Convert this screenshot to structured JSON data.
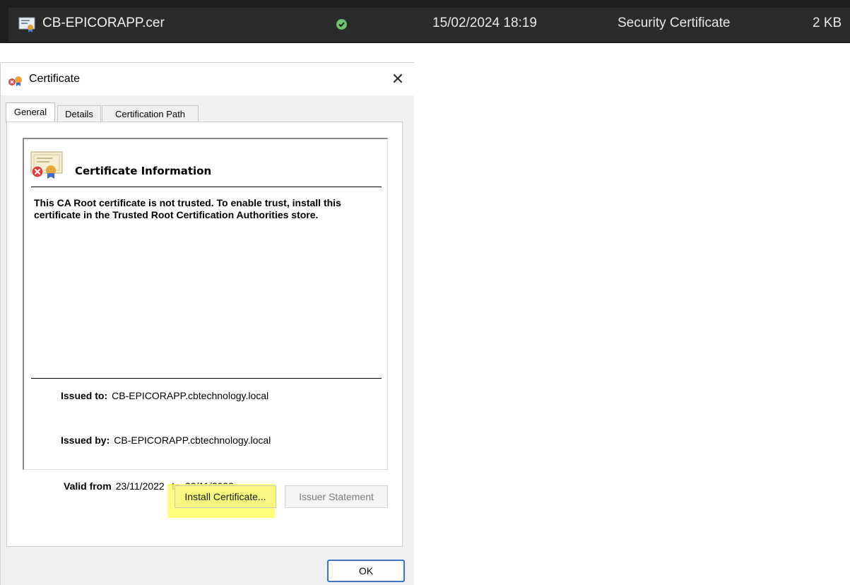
{
  "file_row": {
    "name": "CB-EPICORAPP.cer",
    "date": "15/02/2024 18:19",
    "type": "Security Certificate",
    "size": "2 KB",
    "status_icon": "green-check-icon",
    "file_icon": "certificate-file-icon"
  },
  "dialog": {
    "title": "Certificate",
    "close": "✕",
    "tabs": [
      {
        "label": "General",
        "active": true
      },
      {
        "label": "Details",
        "active": false
      },
      {
        "label": "Certification Path",
        "active": false
      }
    ],
    "info_title": "Certificate Information",
    "warning": "This CA Root certificate is not trusted. To enable trust, install this certificate in the Trusted Root Certification Authorities store.",
    "issued_to_label": "Issued to:",
    "issued_to": "CB-EPICORAPP.cbtechnology.local",
    "issued_by_label": "Issued by:",
    "issued_by": "CB-EPICORAPP.cbtechnology.local",
    "valid_from_label": "Valid from",
    "valid_from": "23/11/2022",
    "valid_to_label": "to",
    "valid_to": "23/11/2032",
    "install_label": "Install Certificate...",
    "issuer_label": "Issuer Statement",
    "ok_label": "OK"
  },
  "colors": {
    "highlight": "#ffff66",
    "ok_border": "#3b76c8",
    "dark_bg": "#1e1e1e"
  }
}
